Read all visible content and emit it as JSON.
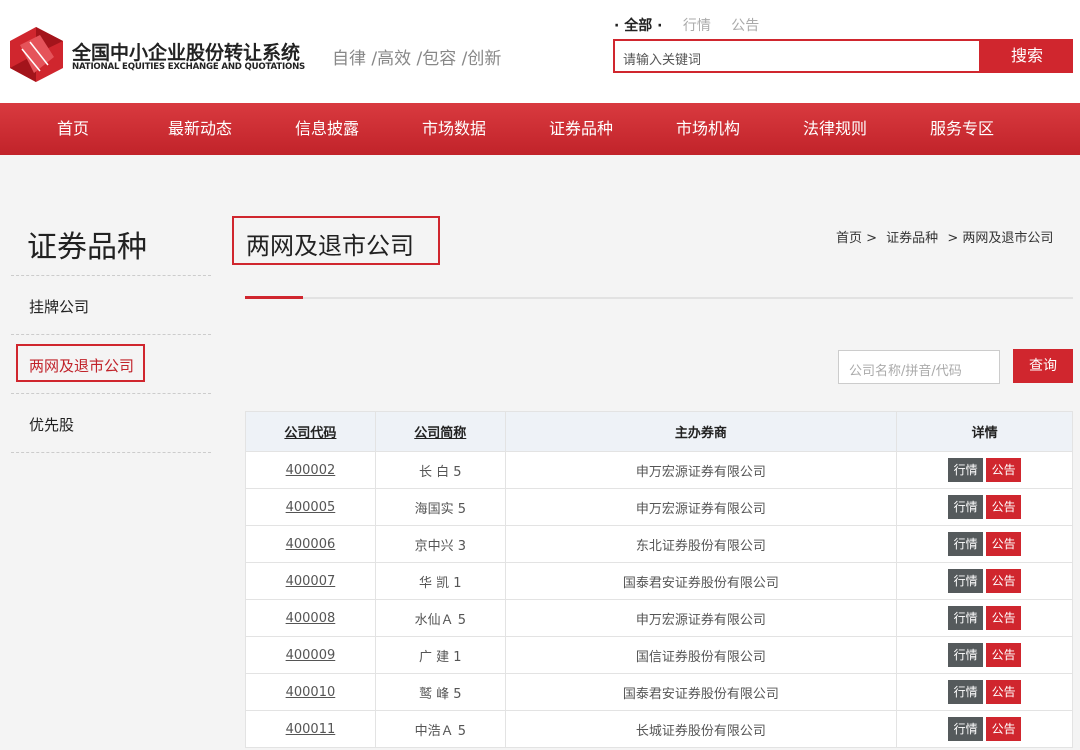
{
  "header": {
    "logo_cn": "全国中小企业股份转让系统",
    "logo_en": "NATIONAL EQUITIES EXCHANGE AND QUOTATIONS",
    "slogan": "自律 /高效 /包容 /创新",
    "scope_tabs": [
      "· 全部 ·",
      "行情",
      "公告"
    ],
    "search_placeholder": "请输入关键词",
    "search_button": "搜索"
  },
  "nav": [
    "首页",
    "最新动态",
    "信息披露",
    "市场数据",
    "证券品种",
    "市场机构",
    "法律规则",
    "服务专区"
  ],
  "sidebar": {
    "title": "证券品种",
    "items": [
      "挂牌公司",
      "两网及退市公司",
      "优先股"
    ]
  },
  "main": {
    "title": "两网及退市公司",
    "breadcrumb": [
      "首页 >",
      "证券品种",
      "> 两网及退市公司"
    ],
    "filter_placeholder": "公司名称/拼音/代码",
    "query_button": "查询",
    "table": {
      "headers": [
        "公司代码",
        "公司简称",
        "主办券商",
        "详情"
      ],
      "btn_hq": "行情",
      "btn_gg": "公告",
      "rows": [
        {
          "code": "400002",
          "name": "长 白 5",
          "broker": "申万宏源证券有限公司"
        },
        {
          "code": "400005",
          "name": "海国实 5",
          "broker": "申万宏源证券有限公司"
        },
        {
          "code": "400006",
          "name": "京中兴 3",
          "broker": "东北证券股份有限公司"
        },
        {
          "code": "400007",
          "name": "华 凯 1",
          "broker": "国泰君安证券股份有限公司"
        },
        {
          "code": "400008",
          "name": "水仙Ａ 5",
          "broker": "申万宏源证券有限公司"
        },
        {
          "code": "400009",
          "name": "广 建 1",
          "broker": "国信证券股份有限公司"
        },
        {
          "code": "400010",
          "name": "鹫 峰 5",
          "broker": "国泰君安证券股份有限公司"
        },
        {
          "code": "400011",
          "name": "中浩Ａ 5",
          "broker": "长城证券股份有限公司"
        }
      ]
    }
  },
  "colors": {
    "brand_red": "#d0262e",
    "nav_red": "#c1232a",
    "dark_button": "#555a5c"
  }
}
